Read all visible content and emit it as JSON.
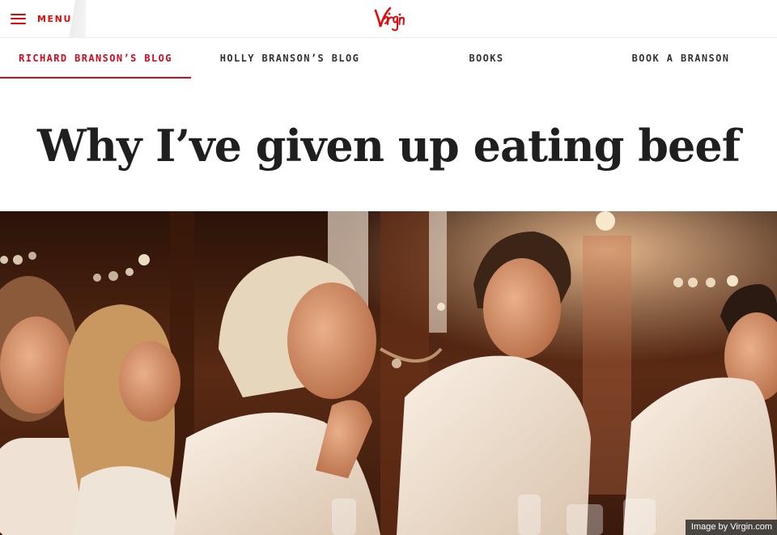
{
  "header": {
    "menu_label": "MENU",
    "logo_text": "Virgin",
    "brand_color": "#e10a0a"
  },
  "nav": {
    "items": [
      {
        "label": "RICHARD BRANSON’S BLOG",
        "active": true
      },
      {
        "label": "HOLLY BRANSON’S BLOG",
        "active": false
      },
      {
        "label": "BOOKS",
        "active": false
      },
      {
        "label": "BOOK A BRANSON",
        "active": false
      }
    ]
  },
  "article": {
    "title": "Why I’ve given up eating beef",
    "image_credit": "Image by Virgin.com"
  }
}
